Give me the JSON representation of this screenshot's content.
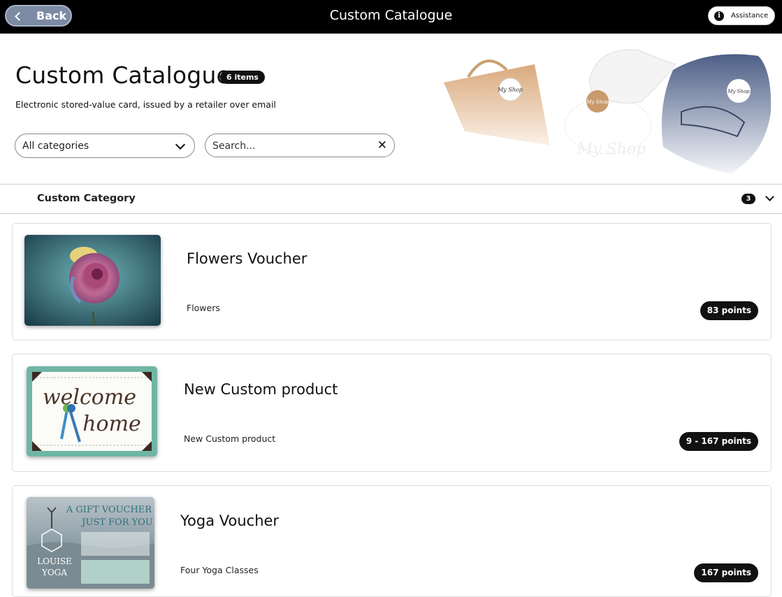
{
  "topbar": {
    "back_label": "Back",
    "title": "Custom Catalogue",
    "assistance_label": "Assistance"
  },
  "header": {
    "title": "Custom Catalogue",
    "item_count_badge": "6 items",
    "subtitle": "Electronic stored-value card, issued by a retailer over email",
    "category_select_value": "All categories",
    "search_placeholder": "Search..."
  },
  "hero": {
    "bag_tag": "My Shop",
    "cap_tag": "My Shop",
    "backpack_tag": "My Shop",
    "watermark": "My Shop"
  },
  "category": {
    "name": "Custom Category",
    "count": "3"
  },
  "products": [
    {
      "name": "Flowers Voucher",
      "description": "Flowers",
      "points": "83 points"
    },
    {
      "name": "New Custom product",
      "description": "New Custom product",
      "points": "9 - 167 points",
      "image_text_1": "welcome",
      "image_text_2": "home"
    },
    {
      "name": "Yoga Voucher",
      "description": "Four Yoga Classes",
      "points": "167 points",
      "image_text_1": "A GIFT VOUCHER",
      "image_text_2": "JUST FOR YOU",
      "image_text_3": "LOUISE",
      "image_text_4": "YOGA"
    }
  ],
  "colors": {
    "topbar_bg": "#000000",
    "back_button": "#7d8aa4",
    "badge_bg": "#111111"
  }
}
